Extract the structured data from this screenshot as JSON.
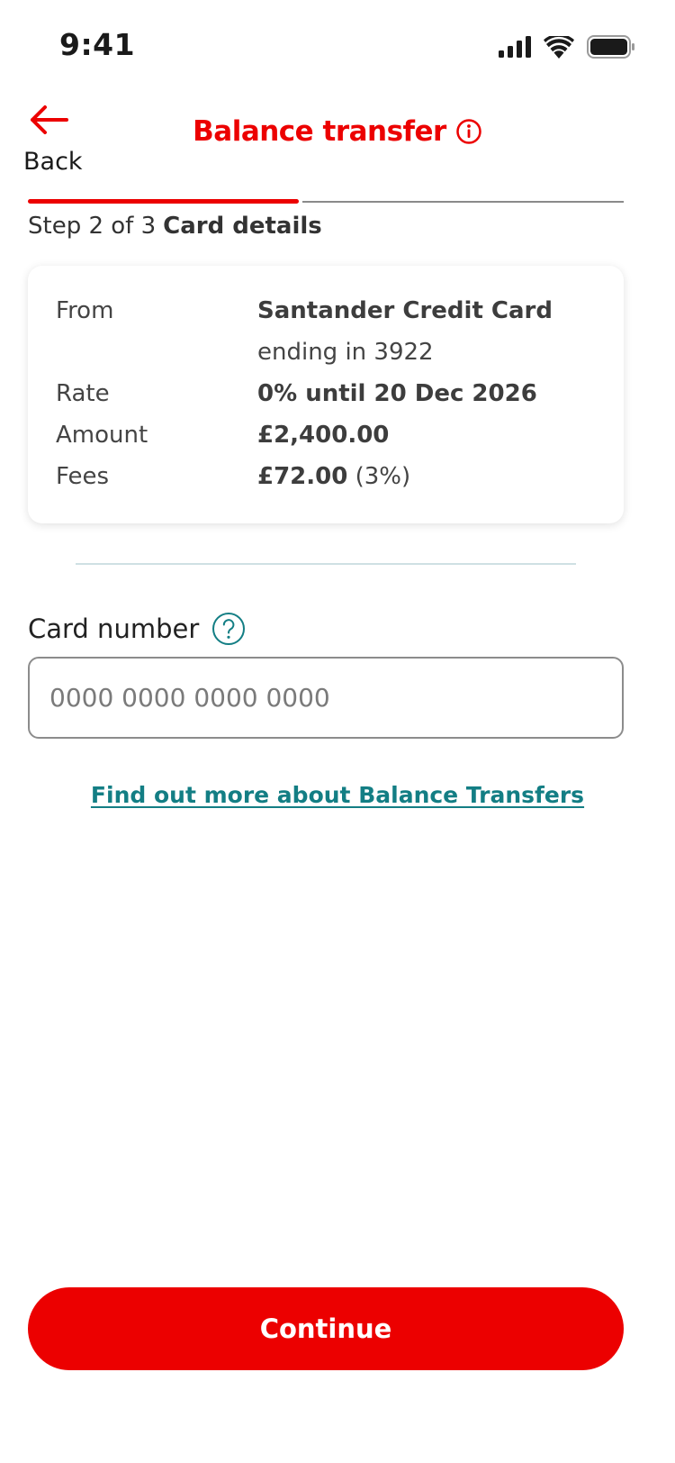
{
  "status_bar": {
    "time": "9:41",
    "icons": [
      "signal-icon",
      "wifi-icon",
      "battery-icon"
    ]
  },
  "header": {
    "back_label": "Back",
    "title": "Balance transfer",
    "info_icon": "info-icon"
  },
  "progress": {
    "current_step": 2,
    "total_steps": 3,
    "step_text": "Step 2 of 3",
    "step_name": "Card details"
  },
  "summary": {
    "from_label": "From",
    "from_value": "Santander Credit Card",
    "from_subvalue": "ending in 3922",
    "rate_label": "Rate",
    "rate_value": "0% until 20 Dec 2026",
    "amount_label": "Amount",
    "amount_value": "£2,400.00",
    "fees_label": "Fees",
    "fees_value": "£72.00",
    "fees_percent": "(3%)"
  },
  "card_number": {
    "label": "Card number",
    "value": "",
    "placeholder": "0000 0000 0000 0000",
    "help_icon": "question-circle-icon"
  },
  "more_link": "Find out more about Balance Transfers",
  "continue_label": "Continue",
  "colors": {
    "brand_red": "#ec0000",
    "link_teal": "#137e84",
    "divider": "#cfe0e3"
  }
}
